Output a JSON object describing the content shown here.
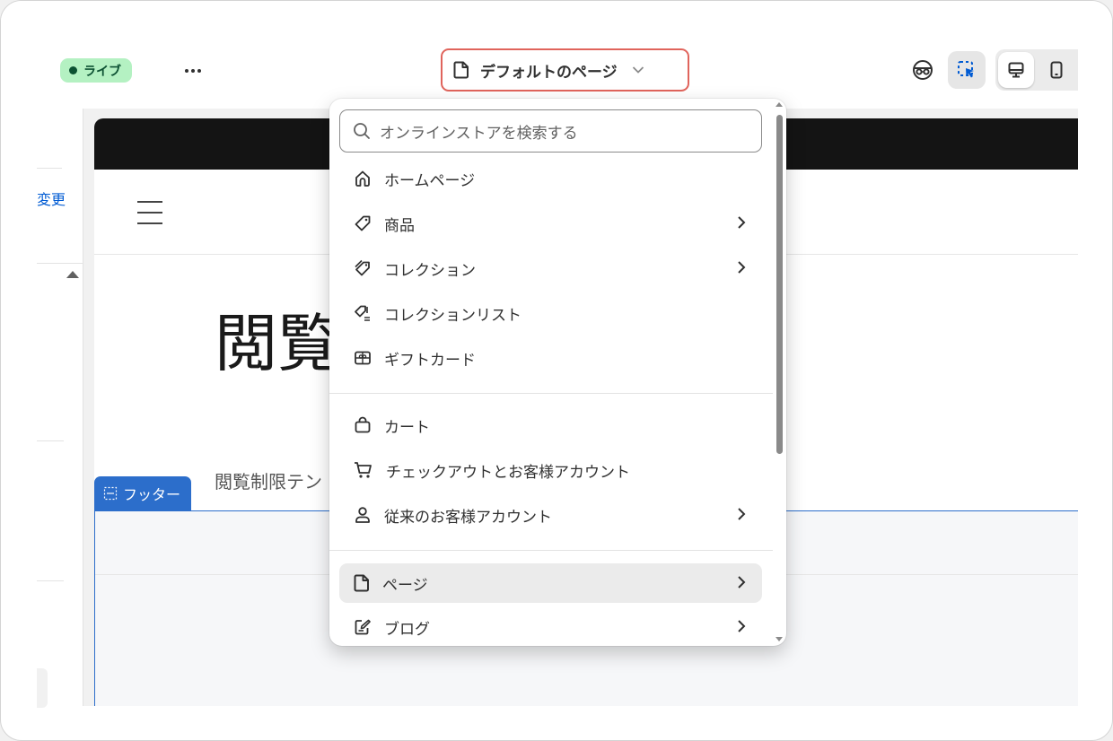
{
  "topbar": {
    "status_label": "ライブ",
    "more_label": "...",
    "page_selector_label": "デフォルトのページ"
  },
  "sidebar": {
    "change_text": "変更"
  },
  "preview": {
    "page_title": "閲覧",
    "body_text": "閲覧制限テン"
  },
  "footer_tag": {
    "label": "フッター"
  },
  "dropdown": {
    "search_placeholder": "オンラインストアを検索する",
    "items": [
      {
        "label": "ホームページ",
        "icon": "home-icon",
        "has_arrow": false
      },
      {
        "label": "商品",
        "icon": "tag-icon",
        "has_arrow": true
      },
      {
        "label": "コレクション",
        "icon": "collection-icon",
        "has_arrow": true
      },
      {
        "label": "コレクションリスト",
        "icon": "collection-list-icon",
        "has_arrow": false
      },
      {
        "label": "ギフトカード",
        "icon": "gift-card-icon",
        "has_arrow": false
      },
      {
        "label": "カート",
        "icon": "bag-icon",
        "has_arrow": false
      },
      {
        "label": "チェックアウトとお客様アカウント",
        "icon": "cart-icon",
        "has_arrow": false
      },
      {
        "label": "従来のお客様アカウント",
        "icon": "person-icon",
        "has_arrow": true
      },
      {
        "label": "ページ",
        "icon": "page-icon",
        "has_arrow": true,
        "selected": true
      },
      {
        "label": "ブログ",
        "icon": "blog-icon",
        "has_arrow": true
      }
    ]
  },
  "colors": {
    "live_badge_bg": "#b4f1c2",
    "highlight_border": "#e0645c",
    "accent_blue": "#2c6ecb"
  }
}
